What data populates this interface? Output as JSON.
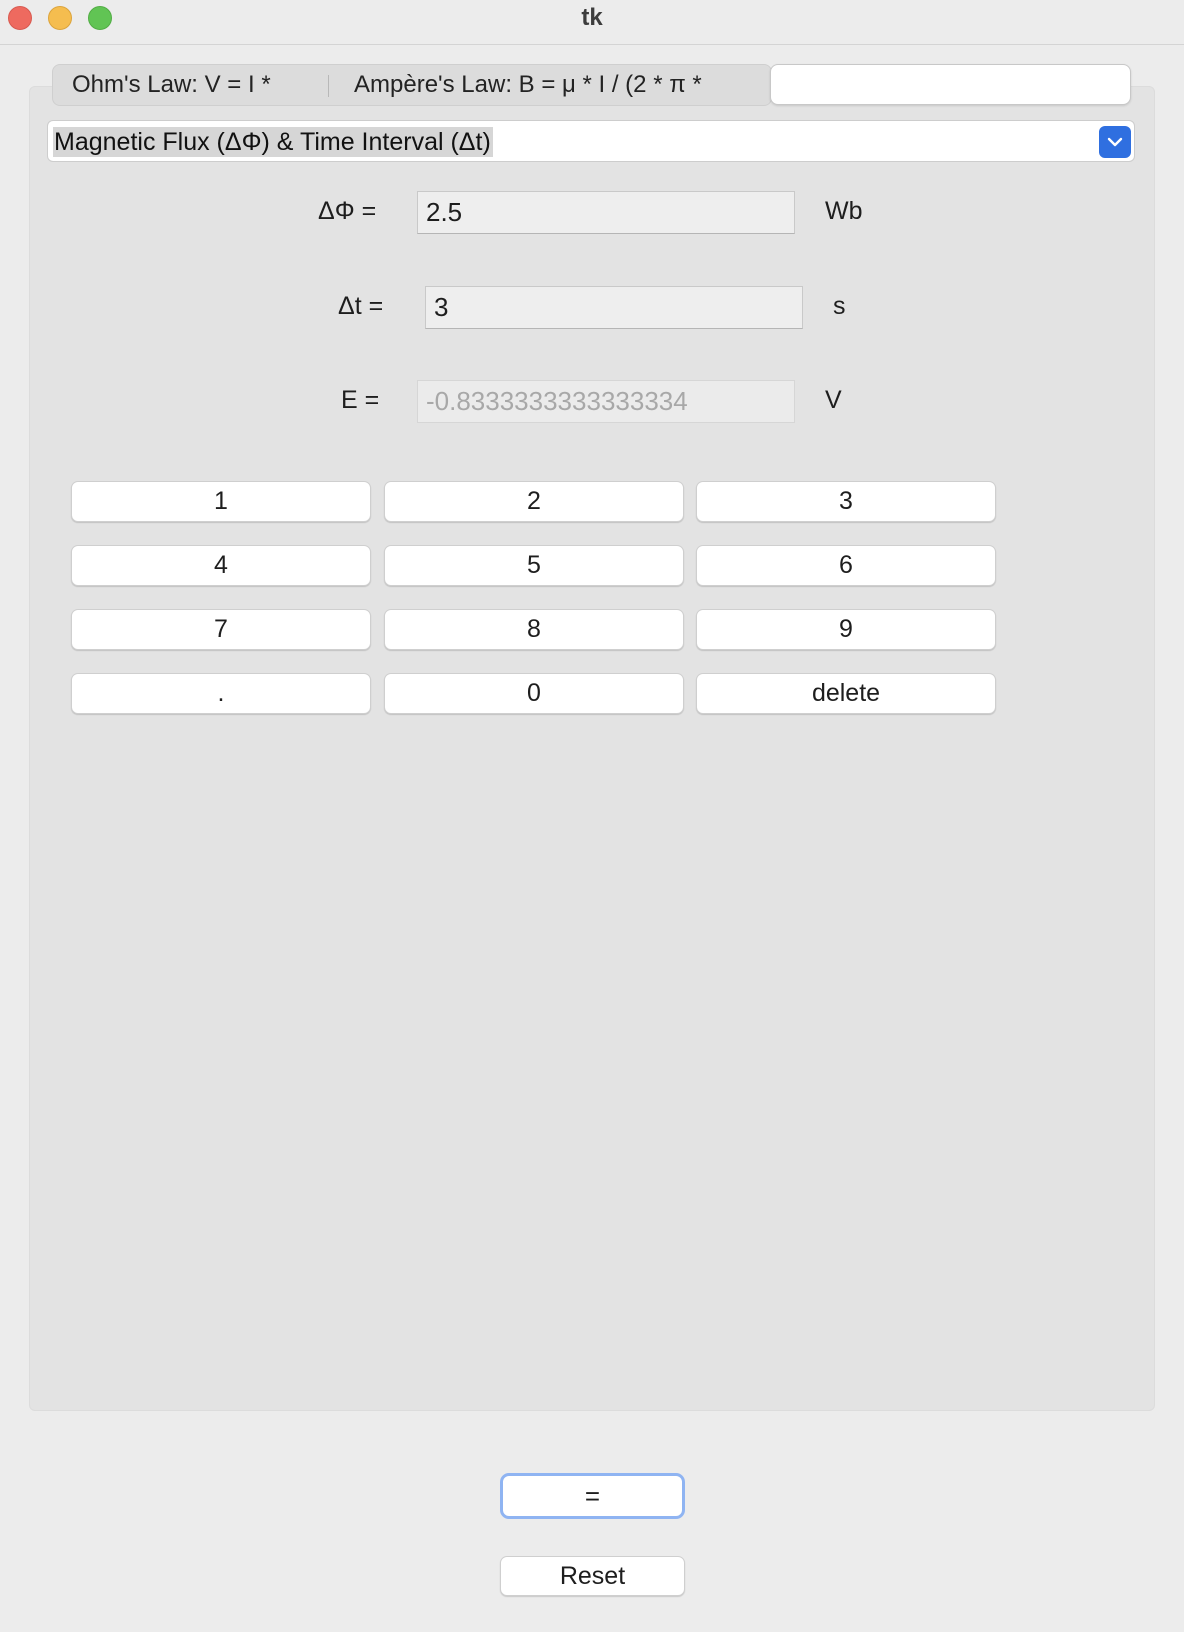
{
  "window": {
    "title": "tk"
  },
  "tabs": [
    {
      "label": "Ohm's Law: V = I *",
      "selected": false
    },
    {
      "label": "Ampère's Law: B = μ * I / (2 * π *",
      "selected": false
    },
    {
      "label": "",
      "selected": true
    }
  ],
  "mode_select": {
    "value": "Magnetic Flux (ΔΦ) & Time Interval (Δt)"
  },
  "form": {
    "flux": {
      "label": "ΔΦ =",
      "value": "2.5",
      "unit": "Wb"
    },
    "time": {
      "label": "Δt =",
      "value": "3",
      "unit": "s"
    },
    "emf": {
      "label": "E =",
      "value": "-0.8333333333333334",
      "unit": "V"
    }
  },
  "keypad": {
    "keys": [
      "1",
      "2",
      "3",
      "4",
      "5",
      "6",
      "7",
      "8",
      "9",
      ".",
      "0",
      "delete"
    ]
  },
  "actions": {
    "equals_label": "=",
    "reset_label": "Reset"
  },
  "colors": {
    "accent": "#2f6fe0",
    "focus_ring": "#8fb4f2",
    "close": "#ee6a5f",
    "minimize": "#f5bd4f",
    "maximize": "#61c454"
  }
}
